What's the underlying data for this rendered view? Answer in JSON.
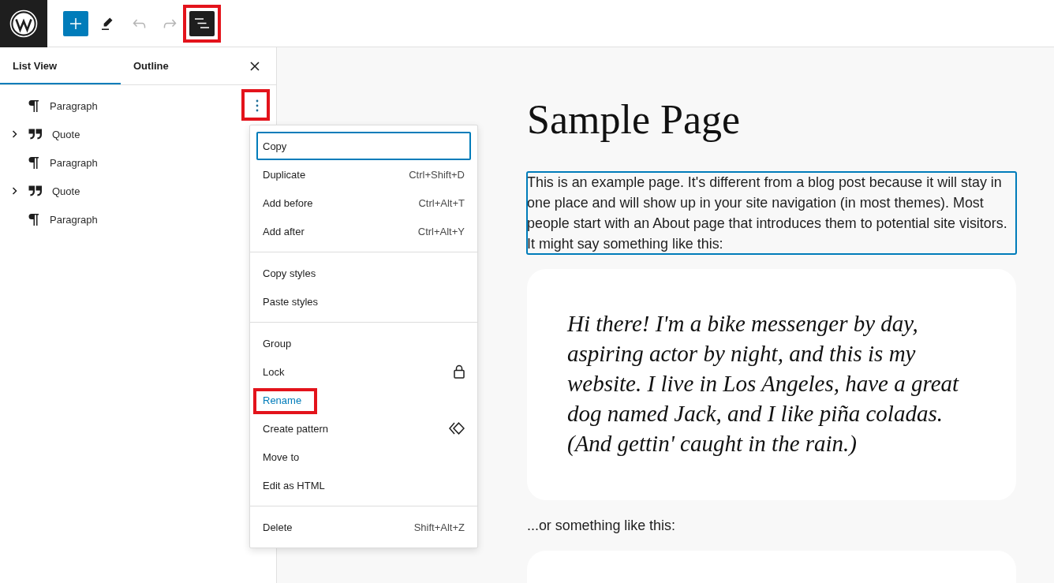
{
  "toolbar": {
    "buttons": [
      {
        "kind": "inserter",
        "disabled": false,
        "pressed": false,
        "highlighted": false
      },
      {
        "kind": "tools",
        "disabled": false,
        "pressed": false,
        "highlighted": false
      },
      {
        "kind": "undo",
        "disabled": true,
        "pressed": false,
        "highlighted": false
      },
      {
        "kind": "redo",
        "disabled": true,
        "pressed": false,
        "highlighted": false
      },
      {
        "kind": "list_view",
        "disabled": false,
        "pressed": true,
        "highlighted": true
      }
    ]
  },
  "sidebar": {
    "tabs": [
      {
        "label": "List View",
        "selected": true
      },
      {
        "label": "Outline",
        "selected": false
      }
    ],
    "tree": [
      {
        "kind": "paragraph",
        "label": "Paragraph",
        "options": {
          "highlighted": true
        }
      },
      {
        "kind": "quote",
        "label": "Quote",
        "expanded": false
      },
      {
        "kind": "paragraph",
        "label": "Paragraph"
      },
      {
        "kind": "quote",
        "label": "Quote",
        "expanded": false
      },
      {
        "kind": "paragraph",
        "label": "Paragraph"
      }
    ]
  },
  "menu": {
    "groups": [
      {
        "items": [
          {
            "kind": "plain",
            "label": "Copy",
            "focused": true,
            "hovered": false,
            "highlighted": false
          },
          {
            "kind": "shortcut",
            "label": "Duplicate",
            "shortcut": "Ctrl+Shift+D",
            "focused": false,
            "hovered": false,
            "highlighted": false
          },
          {
            "kind": "shortcut",
            "label": "Add before",
            "shortcut": "Ctrl+Alt+T",
            "focused": false,
            "hovered": false,
            "highlighted": false
          },
          {
            "kind": "shortcut",
            "label": "Add after",
            "shortcut": "Ctrl+Alt+Y",
            "focused": false,
            "hovered": false,
            "highlighted": false
          }
        ]
      },
      {
        "items": [
          {
            "kind": "plain",
            "label": "Copy styles",
            "focused": false,
            "hovered": false,
            "highlighted": false
          },
          {
            "kind": "plain",
            "label": "Paste styles",
            "focused": false,
            "hovered": false,
            "highlighted": false
          }
        ]
      },
      {
        "items": [
          {
            "kind": "plain",
            "label": "Group",
            "focused": false,
            "hovered": false,
            "highlighted": false
          },
          {
            "kind": "lock",
            "label": "Lock",
            "focused": false,
            "hovered": false,
            "highlighted": false
          },
          {
            "kind": "plain",
            "label": "Rename",
            "focused": false,
            "hovered": true,
            "highlighted": true
          },
          {
            "kind": "pattern",
            "label": "Create pattern",
            "focused": false,
            "hovered": false,
            "highlighted": false
          },
          {
            "kind": "plain",
            "label": "Move to",
            "focused": false,
            "hovered": false,
            "highlighted": false
          },
          {
            "kind": "plain",
            "label": "Edit as HTML",
            "focused": false,
            "hovered": false,
            "highlighted": false
          }
        ]
      },
      {
        "items": [
          {
            "kind": "shortcut",
            "label": "Delete",
            "shortcut": "Shift+Alt+Z",
            "focused": false,
            "hovered": false,
            "highlighted": false
          }
        ]
      }
    ]
  },
  "canvas": {
    "title": "Sample Page",
    "blocks": [
      {
        "kind": "paragraph",
        "text": "This is an example page. It's different from a blog post because it will stay in one place and will show up in your site navigation (in most themes). Most people start with an About page that introduces them to potential site visitors. It might say something like this:",
        "selected": true
      },
      {
        "kind": "quote",
        "text": "Hi there! I'm a bike messenger by day, aspiring actor by night, and this is my website. I live in Los Angeles, have a great dog named Jack, and I like piña coladas. (And gettin' caught in the rain.)",
        "selected": false
      },
      {
        "kind": "paragraph",
        "text": "...or something like this:",
        "selected": false
      },
      {
        "kind": "quote",
        "selected": false
      }
    ]
  }
}
